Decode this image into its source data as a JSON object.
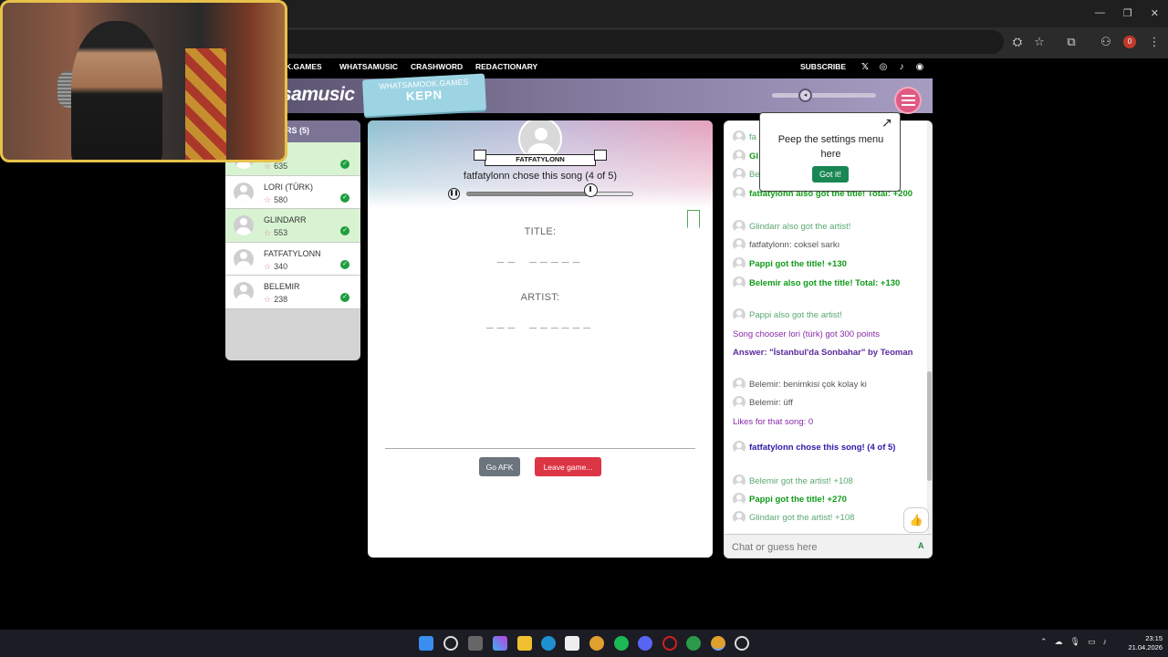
{
  "browser": {
    "toolbar_icons": [
      "translate-icon",
      "star-icon",
      "extensions-icon",
      "profile-icon",
      "menu-icon"
    ],
    "badge_count": "0"
  },
  "site_nav": {
    "links": [
      "K.GAMES",
      "WHATSAMUSIC",
      "CRASHWORD",
      "REDACTIONARY"
    ],
    "subscribe": "SUBSCRIBE"
  },
  "header": {
    "logo": "samusic",
    "banner_line1": "WHATSAMOOK.GAMES",
    "banner_line2": "KEPN",
    "volume": 0.35
  },
  "players": {
    "title": "ERS (5)",
    "list": [
      {
        "name": "",
        "score": "635",
        "state": "green"
      },
      {
        "name": "LORI (TÜRK)",
        "score": "580",
        "state": "white"
      },
      {
        "name": "GLINDARR",
        "score": "553",
        "state": "green"
      },
      {
        "name": "FATFATYLONN",
        "score": "340",
        "state": "white"
      },
      {
        "name": "BELEMIR",
        "score": "238",
        "state": "white"
      }
    ]
  },
  "game": {
    "chooser_name": "FATFATYLONN",
    "chose_text": "fatfatylonn chose this song (4 of 5)",
    "progress": 0.74,
    "title_label": "TITLE:",
    "title_blanks": "__  _____",
    "artist_label": "ARTIST:",
    "artist_blanks": "___  ______",
    "afk_label": "Go AFK",
    "leave_label": "Leave game..."
  },
  "tooltip": {
    "text": "Peep the settings menu here",
    "button": "Got it!"
  },
  "chat": {
    "messages": [
      {
        "text": "fa",
        "cls": "c-light",
        "avatar": true
      },
      {
        "text": "Gl",
        "cls": "c-bold-green",
        "avatar": true
      },
      {
        "text": "Be",
        "cls": "c-light",
        "avatar": true
      },
      {
        "text": "fatfatylonn also got the title! Total: +200",
        "cls": "c-bold-green",
        "avatar": true
      },
      {
        "text": "Glindarr also got the artist!",
        "cls": "c-light",
        "avatar": true
      },
      {
        "text": "fatfatylonn: coksel sarkı",
        "cls": "c-grey",
        "avatar": true
      },
      {
        "text": "Pappi got the title! +130",
        "cls": "c-bold-green",
        "avatar": true
      },
      {
        "text": "Belemir also got the title! Total: +130",
        "cls": "c-bold-green",
        "avatar": true
      },
      {
        "text": "Pappi also got the artist!",
        "cls": "c-light",
        "avatar": true
      },
      {
        "text": "Song chooser lori (türk) got 300 points",
        "cls": "c-purple",
        "avatar": false
      },
      {
        "text": "Answer: \"İstanbul'da Sonbahar\" by Teoman",
        "cls": "c-dpurple",
        "avatar": false
      },
      {
        "text": "Belemir: benimkisi çok kolay ki",
        "cls": "c-grey",
        "avatar": true
      },
      {
        "text": "Belemir: üff",
        "cls": "c-grey",
        "avatar": true
      },
      {
        "text": "Likes for that song: 0",
        "cls": "c-purple",
        "avatar": false
      },
      {
        "text": "fatfatylonn chose this song! (4 of 5)",
        "cls": "c-blue",
        "avatar": true
      },
      {
        "text": "Belemir got the artist! +108",
        "cls": "c-light",
        "avatar": true
      },
      {
        "text": "Pappi got the title! +270",
        "cls": "c-bold-green",
        "avatar": true
      },
      {
        "text": "Glindarr got the artist! +108",
        "cls": "c-light",
        "avatar": true
      }
    ],
    "input_placeholder": "Chat or guess here",
    "send_label": "A"
  },
  "taskbar": {
    "time": "23:15",
    "date": "21.04.2026"
  }
}
